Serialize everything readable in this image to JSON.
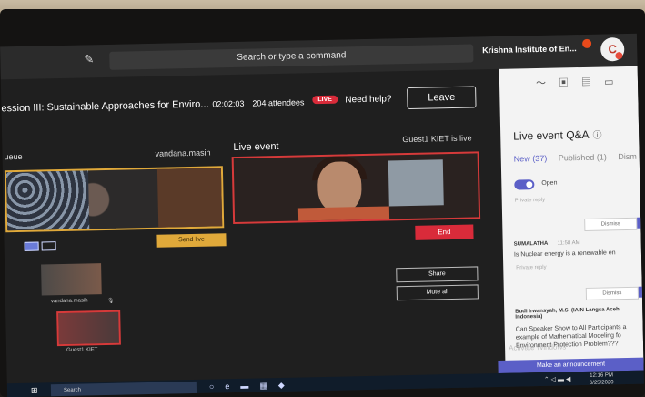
{
  "topbar": {
    "search_placeholder": "Search or type a command",
    "org_name": "Krishna Institute of En...",
    "avatar_initial": "C"
  },
  "meeting": {
    "title": "ession III: Sustainable Approaches for Enviro...",
    "timer": "02:02:03",
    "attendees": "204 attendees",
    "live_badge": "LIVE",
    "help": "Need help?",
    "leave": "Leave"
  },
  "stage": {
    "queue_label": "ueue",
    "queue_presenter": "vandana.masih",
    "live_event_label": "Live event",
    "live_status": "Guest1 KIET is live",
    "send_live": "Send live",
    "end": "End",
    "share": "Share",
    "mute_all": "Mute all",
    "thumbnails": [
      {
        "name": "vandana.masih"
      },
      {
        "name": "Guest1 KIET"
      }
    ]
  },
  "qa_panel": {
    "title": "Live event Q&A",
    "tabs": [
      "New (37)",
      "Published (1)",
      "Dism"
    ],
    "open_label": "Open",
    "private_reply": "Private reply",
    "dismiss": "Dismiss",
    "questions": [
      {
        "author": "SUMALATHA",
        "time": "11:58 AM",
        "text": "Is Nuclear energy is a renewable en"
      },
      {
        "author": "Budi Irwansyah, M.Si (IAIN Langsa Aceh, Indonesia)",
        "time": "",
        "text": "Can Speaker Show to All Participants a example of Mathematical Modeling fo Environment Protection Problem???"
      }
    ],
    "announce": "Make an announcement",
    "activate_windows": "Activate Windows"
  },
  "taskbar": {
    "search": "Search",
    "time": "12:16 PM",
    "date": "6/25/2020"
  }
}
